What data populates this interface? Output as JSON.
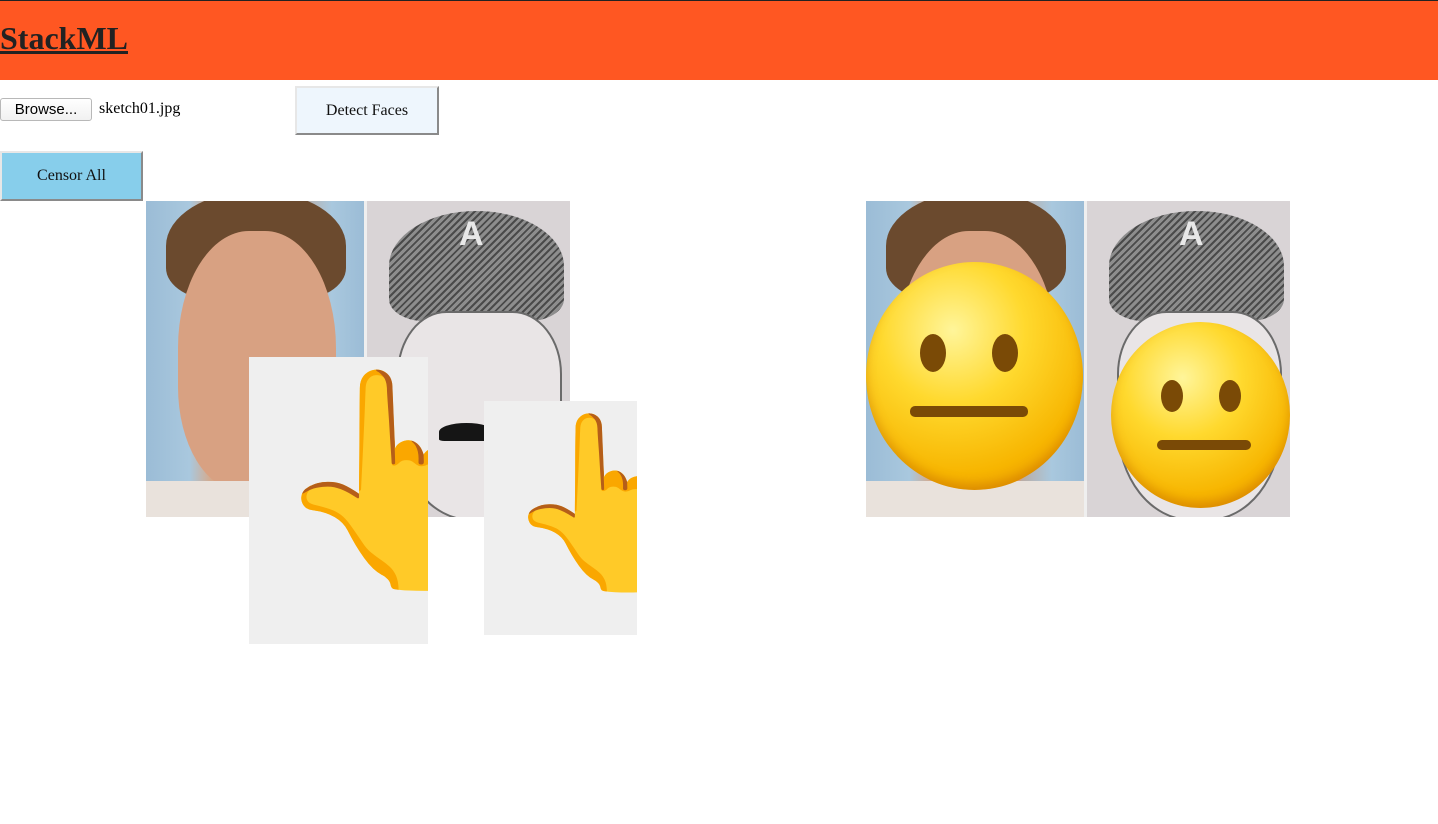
{
  "header": {
    "brand": "StackML",
    "background_color": "#ff5722"
  },
  "upload": {
    "browse_label": "Browse...",
    "file_name": "sketch01.jpg"
  },
  "actions": {
    "detect_label": "Detect Faces",
    "censor_label": "Censor All",
    "censor_color": "#87ceeb"
  },
  "images": {
    "source": {
      "stickers": [
        {
          "icon": "pointing-up-emoji",
          "glyph": "👆"
        },
        {
          "icon": "pointing-up-emoji",
          "glyph": "👆"
        }
      ]
    },
    "censored": {
      "overlays": [
        {
          "icon": "neutral-face-emoji"
        },
        {
          "icon": "neutral-face-emoji"
        }
      ]
    }
  }
}
